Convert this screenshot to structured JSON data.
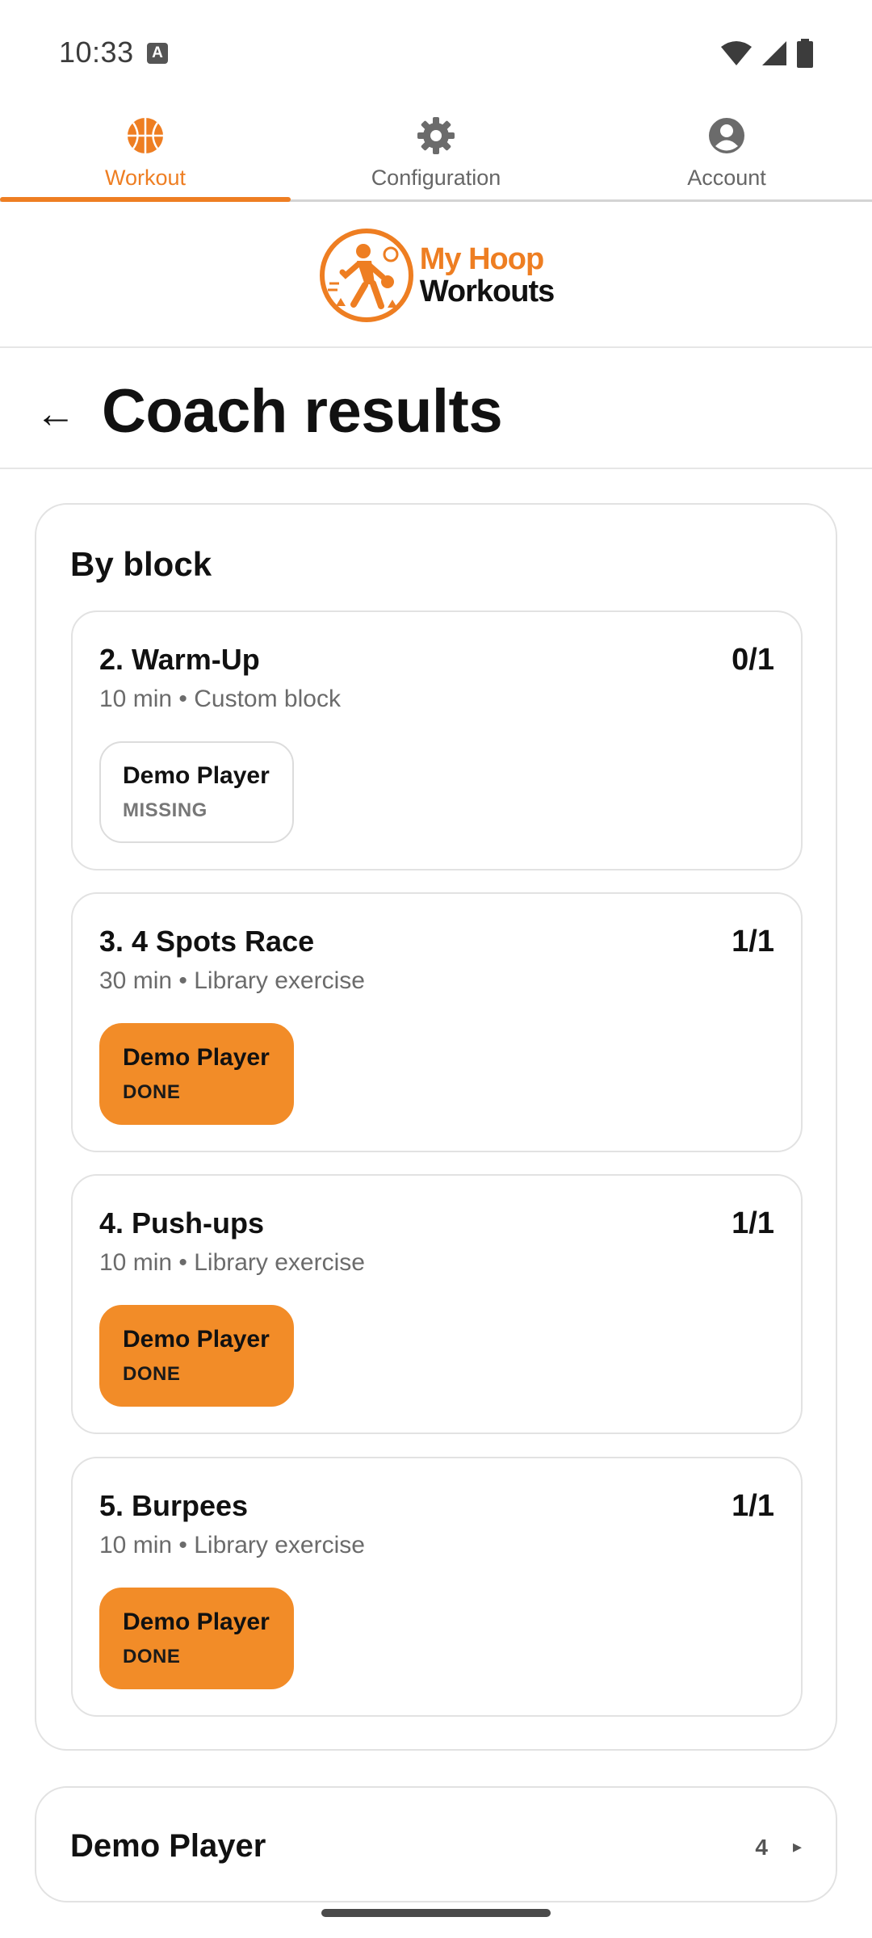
{
  "status_bar": {
    "time": "10:33",
    "notification_icon": "a-icon",
    "icons": [
      "wifi-icon",
      "signal-icon",
      "battery-icon"
    ]
  },
  "tabs": [
    {
      "label": "Workout",
      "icon": "basketball-icon",
      "active": true
    },
    {
      "label": "Configuration",
      "icon": "gear-icon",
      "active": false
    },
    {
      "label": "Account",
      "icon": "account-icon",
      "active": false
    }
  ],
  "logo": {
    "line1": "My Hoop",
    "line2": "Workouts"
  },
  "header": {
    "back_icon": "back-arrow-icon",
    "back_glyph": "←",
    "title": "Coach results"
  },
  "by_block": {
    "title": "By block",
    "items": [
      {
        "title": "2. Warm-Up",
        "count": "0/1",
        "meta": "10 min • Custom block",
        "player": "Demo Player",
        "status": "MISSING"
      },
      {
        "title": "3. 4 Spots Race",
        "count": "1/1",
        "meta": "30 min • Library exercise",
        "player": "Demo Player",
        "status": "DONE"
      },
      {
        "title": "4. Push-ups",
        "count": "1/1",
        "meta": "10 min • Library exercise",
        "player": "Demo Player",
        "status": "DONE"
      },
      {
        "title": "5. Burpees",
        "count": "1/1",
        "meta": "10 min • Library exercise",
        "player": "Demo Player",
        "status": "DONE"
      }
    ]
  },
  "player_section": {
    "name": "Demo Player",
    "count": "4",
    "caret": "▸"
  },
  "colors": {
    "accent": "#ee7e22",
    "done_chip": "#f28c28",
    "border": "#e2e2e2"
  }
}
